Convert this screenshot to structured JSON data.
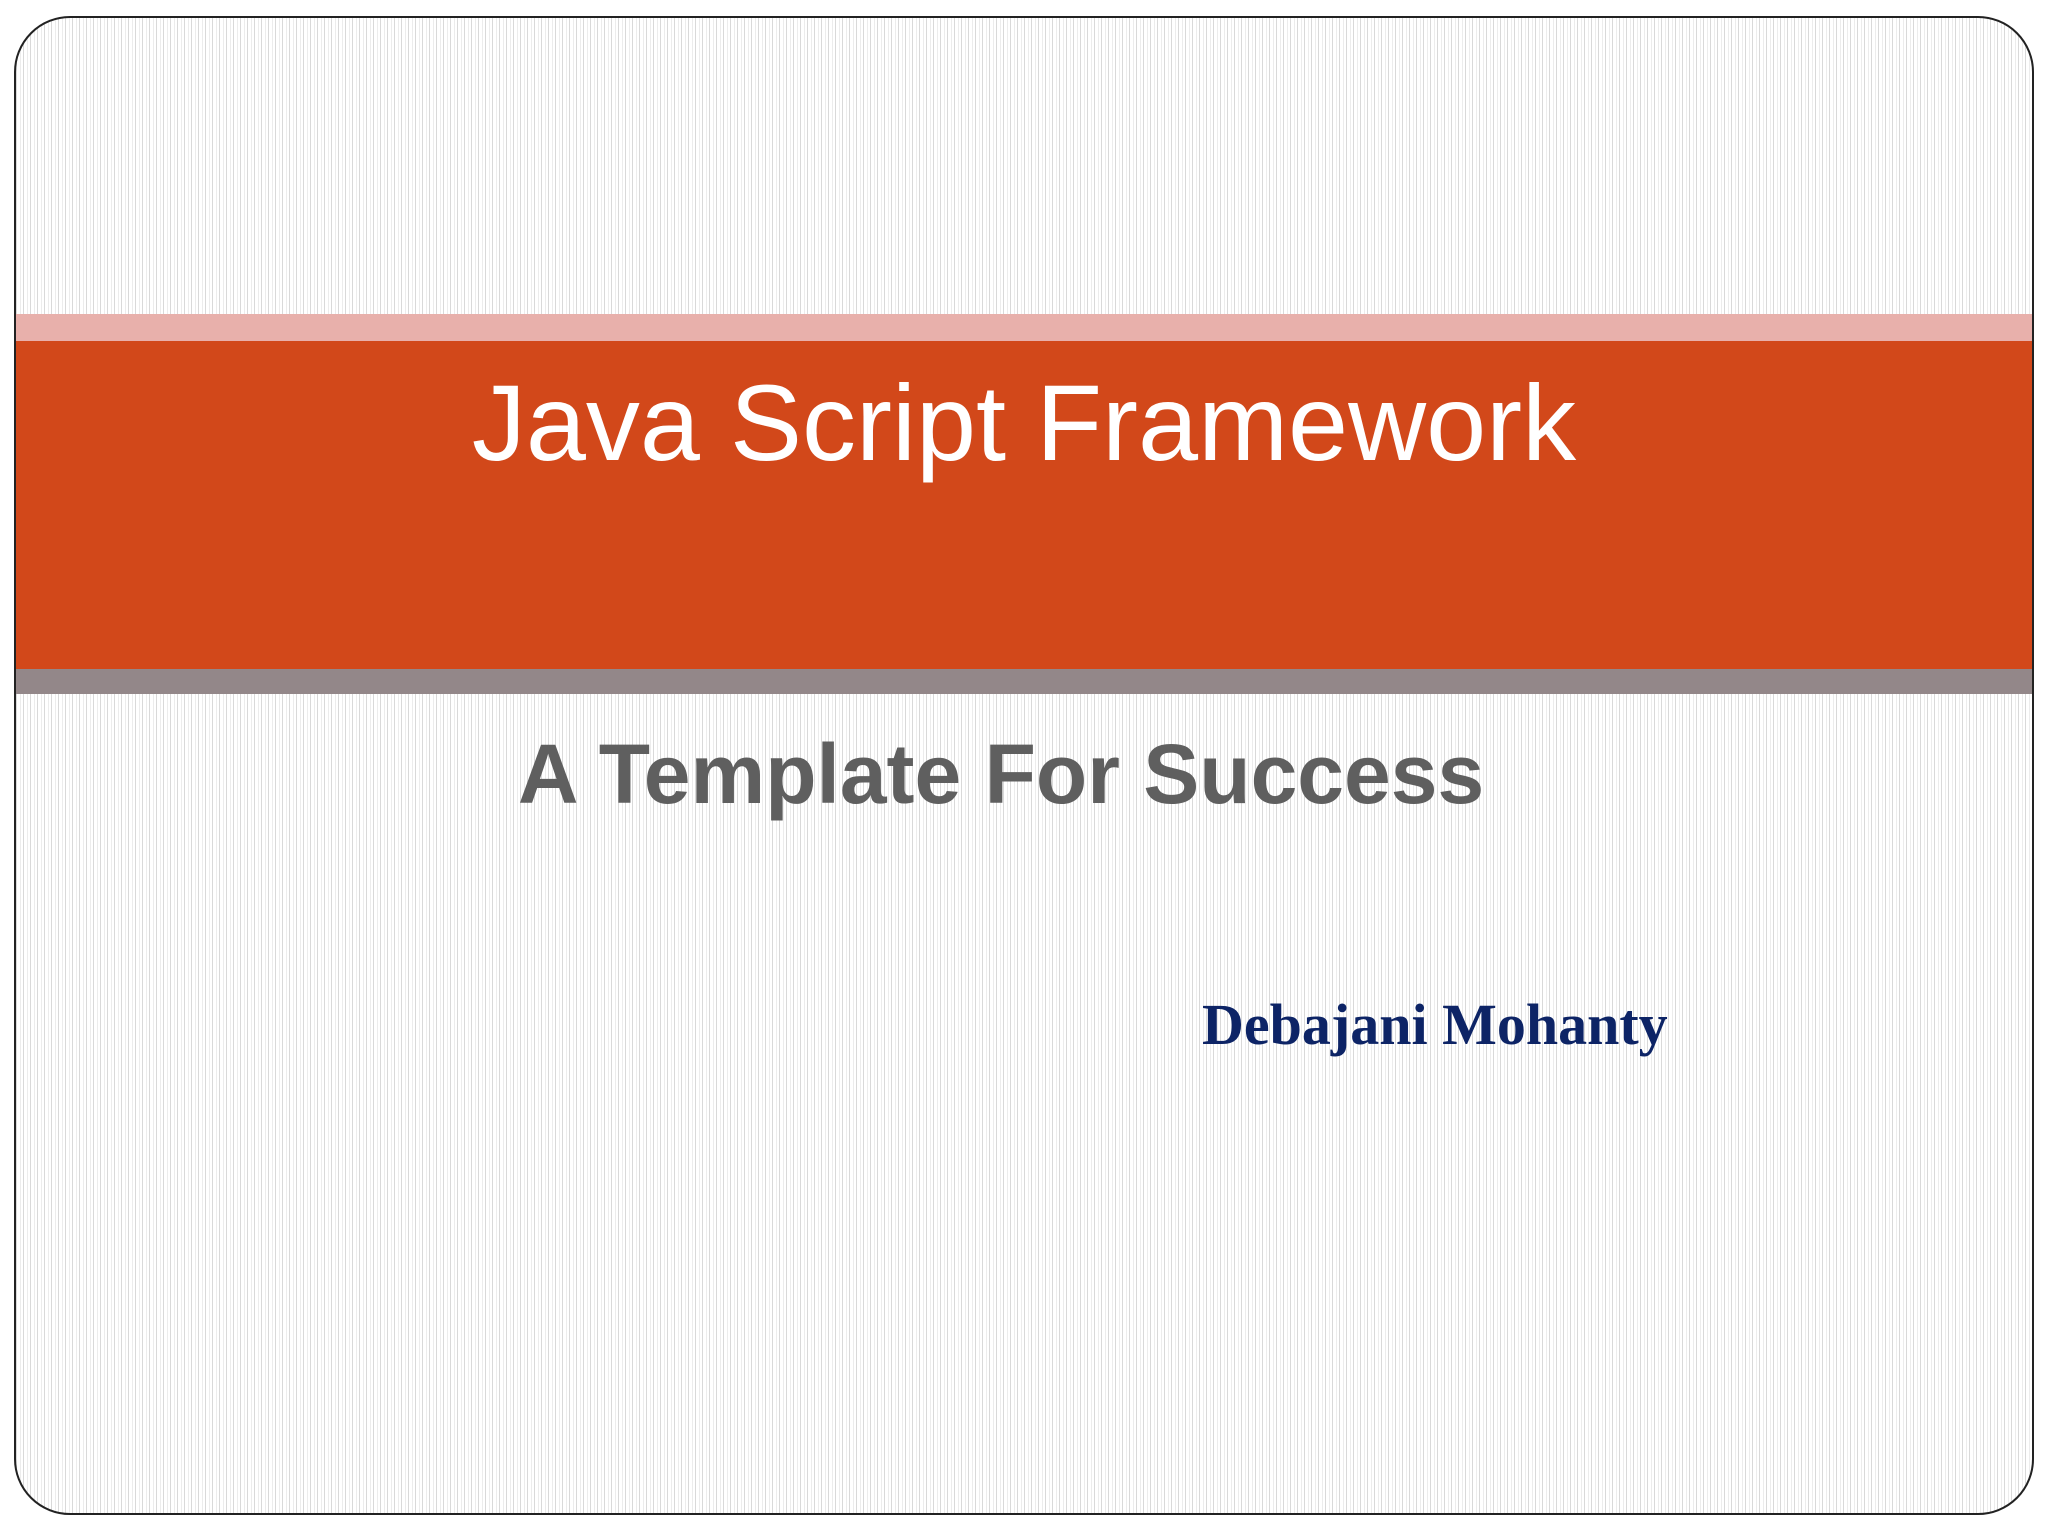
{
  "slide": {
    "title": "Java Script Framework",
    "subtitle": "A Template For Success",
    "author": "Debajani Mohanty"
  },
  "colors": {
    "band_top": "#e8b0ab",
    "band_main": "#d2481a",
    "band_bottom": "#938789",
    "title_text": "#ffffff",
    "subtitle_text": "#5f5f5f",
    "author_text": "#0d2466"
  }
}
